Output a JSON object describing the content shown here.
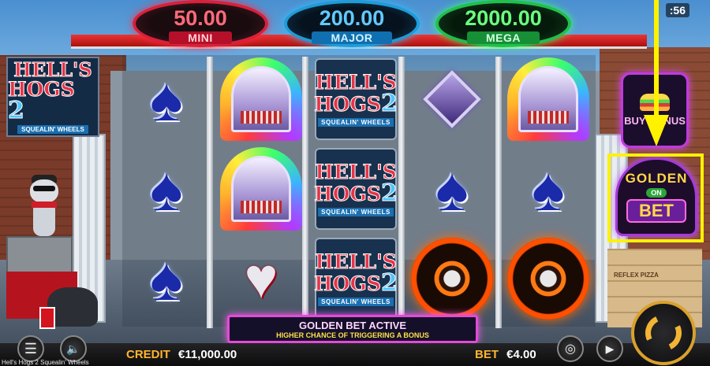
{
  "jackpots": [
    {
      "value": "50.00",
      "label": "MINI"
    },
    {
      "value": "200.00",
      "label": "MAJOR"
    },
    {
      "value": "2000.00",
      "label": "MEGA"
    }
  ],
  "clock": ":56",
  "game_logo": {
    "line1": "HELL'S",
    "line2": "HOGS",
    "number": "2",
    "subtitle": "SQUEALIN' WHEELS"
  },
  "reels": [
    [
      "spade",
      "spade",
      "spade"
    ],
    [
      "jukebox",
      "jukebox",
      "heart"
    ],
    [
      "logo",
      "logo",
      "logo"
    ],
    [
      "diamond",
      "spade",
      "wheel"
    ],
    [
      "jukebox",
      "spade",
      "wheel"
    ]
  ],
  "buy_bonus": {
    "label": "BUY BONUS"
  },
  "golden_bet": {
    "top": "GOLDEN",
    "middle": "ON",
    "bottom": "BET"
  },
  "banner": {
    "title": "GOLDEN BET ACTIVE",
    "subtitle": "HIGHER CHANCE OF TRIGGERING A BONUS"
  },
  "bottom": {
    "credit_label": "CREDIT",
    "credit_value": "€11,000.00",
    "bet_label": "BET",
    "bet_value": "€4.00",
    "game_name": "Hell's Hogs 2 Squealin' Wheels"
  },
  "props": {
    "pizza_label": "REFLEX PIZZA"
  },
  "icons": {
    "menu": "hamburger-menu-icon",
    "sound": "speaker-muted-icon",
    "chips": "chip-stack-icon",
    "autoplay": "play-icon",
    "spin": "spin-arrows-icon"
  },
  "colors": {
    "accent_gold": "#f3b533",
    "highlight": "#fff200",
    "neon_pink": "#e44ad8"
  }
}
